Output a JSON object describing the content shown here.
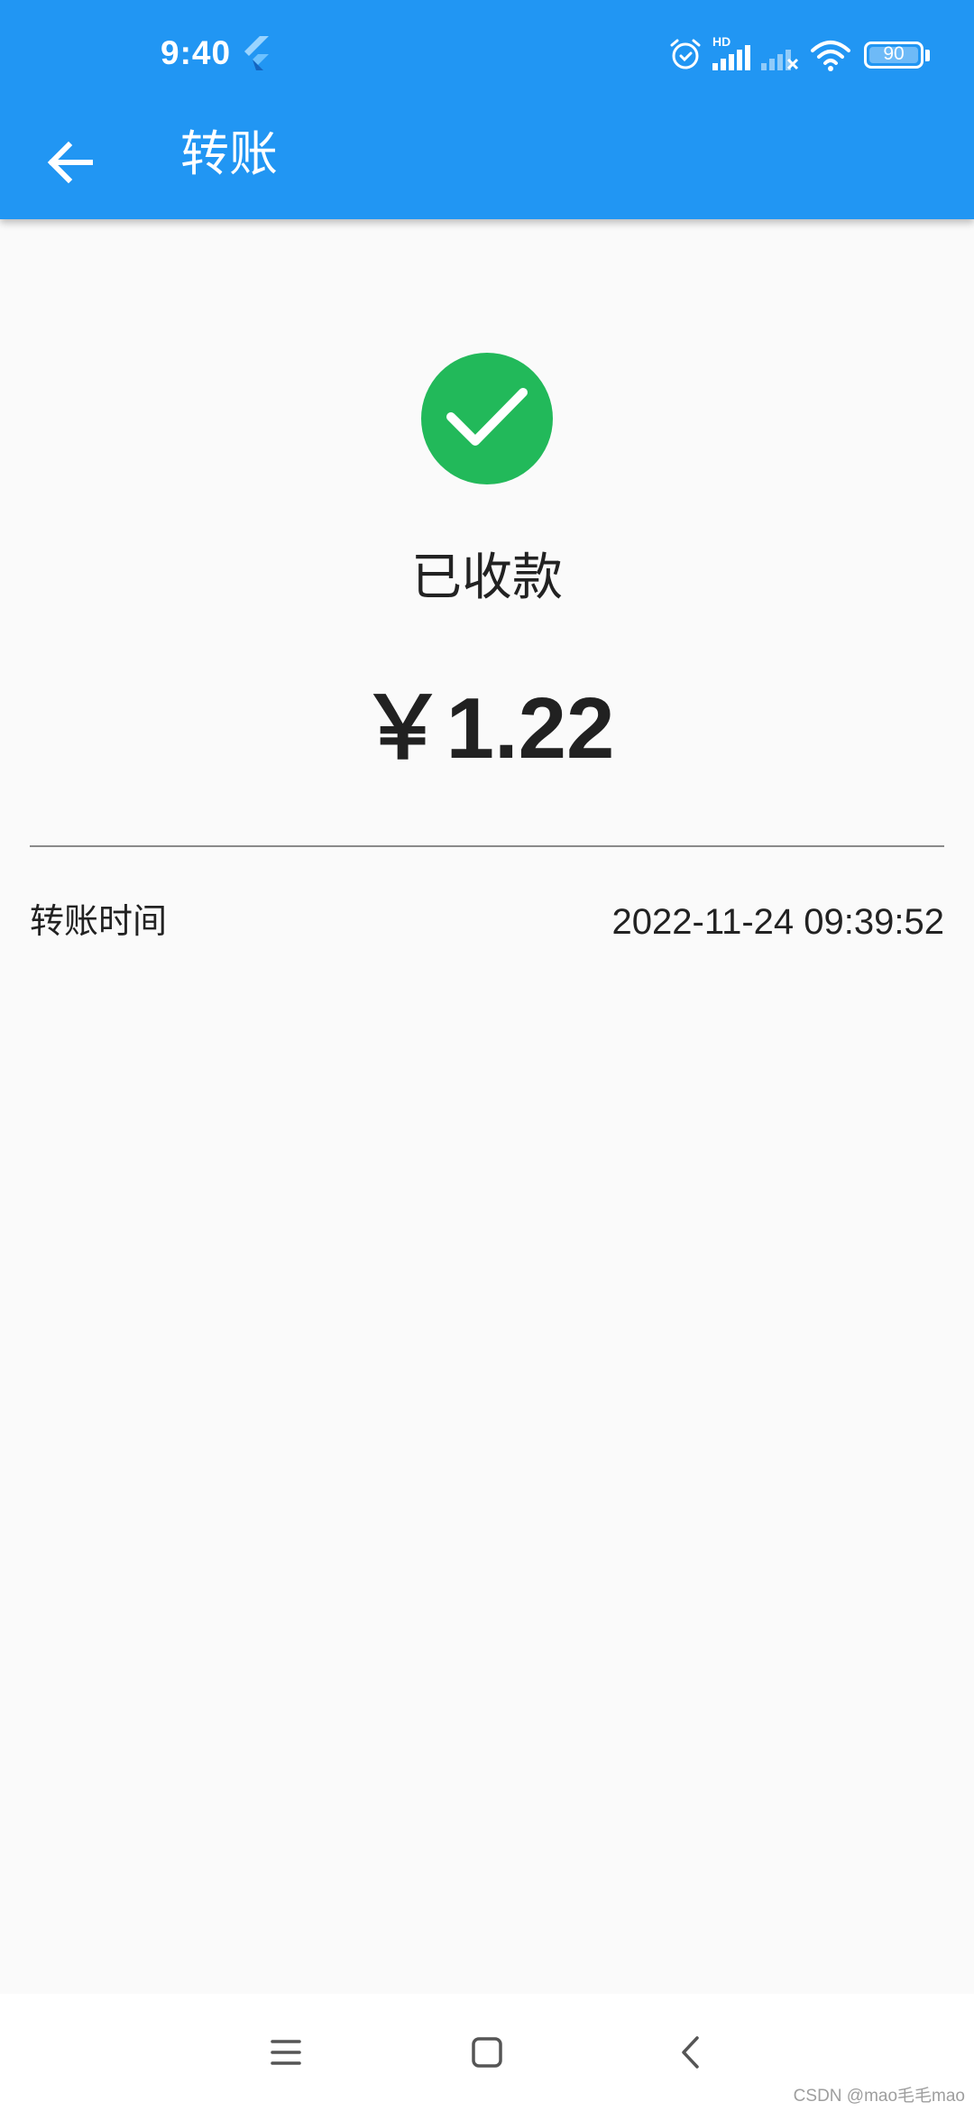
{
  "status_bar": {
    "time": "9:40",
    "network_label": "HD",
    "battery_level": "90",
    "icons": [
      "flutter-icon",
      "alarm-icon",
      "signal-icon",
      "signal-off-icon",
      "wifi-icon",
      "battery-icon"
    ]
  },
  "app_bar": {
    "title": "转账",
    "back_icon": "arrow-left-icon",
    "color": "#2196f3"
  },
  "receipt": {
    "status_icon": "check-circle-icon",
    "status_color": "#22b95a",
    "status_text": "已收款",
    "amount": "￥1.22",
    "details": [
      {
        "label": "转账时间",
        "value": "2022-11-24 09:39:52"
      }
    ]
  },
  "nav_bar": {
    "icons": [
      "menu-icon",
      "home-icon",
      "back-icon"
    ]
  },
  "watermark": "CSDN @mao毛毛mao"
}
